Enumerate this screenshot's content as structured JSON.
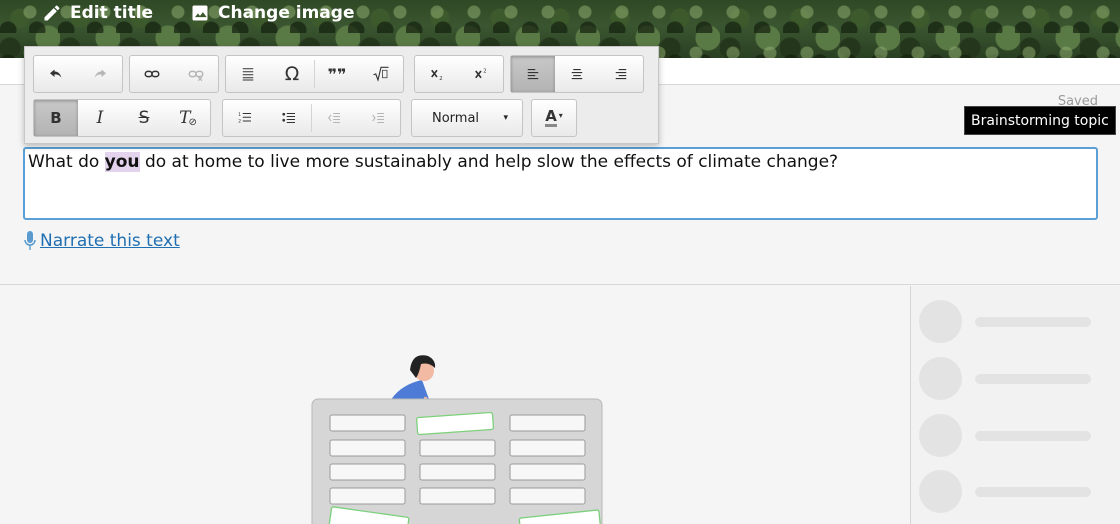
{
  "banner": {
    "edit_title_label": "Edit title",
    "change_image_label": "Change image"
  },
  "status": {
    "saved": "Saved",
    "tooltip": "Brainstorming topic"
  },
  "editor": {
    "text_before": "What do ",
    "text_highlight": "you",
    "text_after": " do at home to live more sustainably and help slow the effects of climate change?"
  },
  "narrate_label": "Narrate this text",
  "toolbar": {
    "format_value": "Normal",
    "omega": "Ω",
    "quote": "❞❞",
    "bold": "B",
    "italic": "I",
    "strike": "S",
    "clear": "T",
    "font_color": "A"
  },
  "colors": {
    "accent_border": "#5aa0d6",
    "link": "#1f6fb2",
    "highlight": "#e3d3ec"
  }
}
